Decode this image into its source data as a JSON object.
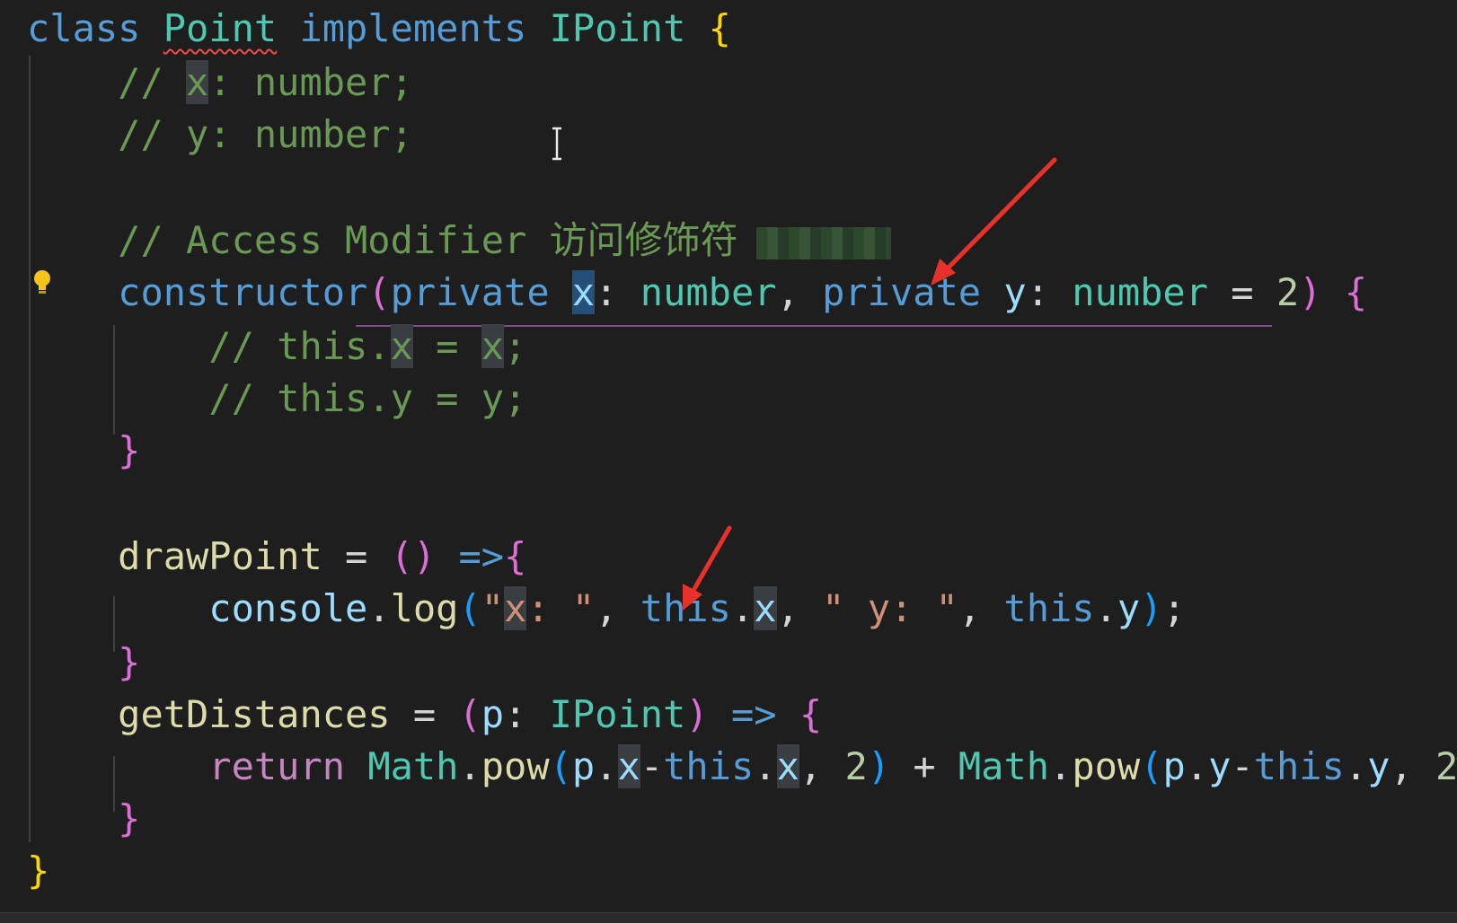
{
  "editor": {
    "lines": [
      {
        "tokens": [
          {
            "t": "class",
            "c": "kw"
          },
          {
            "t": " ",
            "c": ""
          },
          {
            "t": "Point",
            "c": "cls squiggle"
          },
          {
            "t": " ",
            "c": ""
          },
          {
            "t": "implements",
            "c": "kw"
          },
          {
            "t": " ",
            "c": ""
          },
          {
            "t": "IPoint",
            "c": "cls"
          },
          {
            "t": " ",
            "c": ""
          },
          {
            "t": "{",
            "c": "p1"
          }
        ]
      },
      {
        "tokens": [
          {
            "t": "    ",
            "c": ""
          },
          {
            "t": "// ",
            "c": "cm"
          },
          {
            "t": "x",
            "c": "cm hl"
          },
          {
            "t": ": number;",
            "c": "cm"
          }
        ]
      },
      {
        "tokens": [
          {
            "t": "    ",
            "c": ""
          },
          {
            "t": "// y: number;",
            "c": "cm"
          }
        ]
      },
      {
        "tokens": [
          {
            "t": "",
            "c": ""
          }
        ]
      },
      {
        "tokens": [
          {
            "t": "    ",
            "c": ""
          },
          {
            "t": "// Access Modifier 访问修饰符",
            "c": "cm"
          }
        ],
        "blur": true
      },
      {
        "tokens": [
          {
            "t": "    ",
            "c": ""
          },
          {
            "t": "constructor",
            "c": "kw"
          },
          {
            "t": "(",
            "c": "p2"
          },
          {
            "t": "private",
            "c": "kw"
          },
          {
            "t": " ",
            "c": ""
          },
          {
            "t": "x",
            "c": "var sel"
          },
          {
            "t": ": ",
            "c": ""
          },
          {
            "t": "number",
            "c": "cls"
          },
          {
            "t": ", ",
            "c": ""
          },
          {
            "t": "private",
            "c": "kw"
          },
          {
            "t": " ",
            "c": ""
          },
          {
            "t": "y",
            "c": "var"
          },
          {
            "t": ": ",
            "c": ""
          },
          {
            "t": "number",
            "c": "cls"
          },
          {
            "t": " = ",
            "c": ""
          },
          {
            "t": "2",
            "c": "num"
          },
          {
            "t": ")",
            "c": "p2"
          },
          {
            "t": " ",
            "c": ""
          },
          {
            "t": "{",
            "c": "p2"
          }
        ]
      },
      {
        "tokens": [
          {
            "t": "        ",
            "c": ""
          },
          {
            "t": "// this.",
            "c": "cm"
          },
          {
            "t": "x",
            "c": "cm hl"
          },
          {
            "t": " = ",
            "c": "cm"
          },
          {
            "t": "x",
            "c": "cm hl"
          },
          {
            "t": ";",
            "c": "cm"
          }
        ]
      },
      {
        "tokens": [
          {
            "t": "        ",
            "c": ""
          },
          {
            "t": "// this.y = y;",
            "c": "cm"
          }
        ]
      },
      {
        "tokens": [
          {
            "t": "    ",
            "c": ""
          },
          {
            "t": "}",
            "c": "p2"
          }
        ]
      },
      {
        "tokens": [
          {
            "t": "",
            "c": ""
          }
        ]
      },
      {
        "tokens": [
          {
            "t": "    ",
            "c": ""
          },
          {
            "t": "drawPoint",
            "c": "fn"
          },
          {
            "t": " = ",
            "c": ""
          },
          {
            "t": "()",
            "c": "p2"
          },
          {
            "t": " ",
            "c": ""
          },
          {
            "t": "=>",
            "c": "kw"
          },
          {
            "t": "{",
            "c": "p2"
          }
        ]
      },
      {
        "tokens": [
          {
            "t": "        ",
            "c": ""
          },
          {
            "t": "console",
            "c": "var"
          },
          {
            "t": ".",
            "c": ""
          },
          {
            "t": "log",
            "c": "fn"
          },
          {
            "t": "(",
            "c": "p3"
          },
          {
            "t": "\"",
            "c": "str"
          },
          {
            "t": "x",
            "c": "str hl"
          },
          {
            "t": ": \"",
            "c": "str"
          },
          {
            "t": ", ",
            "c": ""
          },
          {
            "t": "this",
            "c": "kw"
          },
          {
            "t": ".",
            "c": ""
          },
          {
            "t": "x",
            "c": "var hl"
          },
          {
            "t": ", ",
            "c": ""
          },
          {
            "t": "\" y: \"",
            "c": "str"
          },
          {
            "t": ", ",
            "c": ""
          },
          {
            "t": "this",
            "c": "kw"
          },
          {
            "t": ".",
            "c": ""
          },
          {
            "t": "y",
            "c": "var"
          },
          {
            "t": ")",
            "c": "p3"
          },
          {
            "t": ";",
            "c": ""
          }
        ]
      },
      {
        "tokens": [
          {
            "t": "    ",
            "c": ""
          },
          {
            "t": "}",
            "c": "p2"
          }
        ]
      },
      {
        "tokens": [
          {
            "t": "    ",
            "c": ""
          },
          {
            "t": "getDistances",
            "c": "fn"
          },
          {
            "t": " = ",
            "c": ""
          },
          {
            "t": "(",
            "c": "p2"
          },
          {
            "t": "p",
            "c": "var"
          },
          {
            "t": ": ",
            "c": ""
          },
          {
            "t": "IPoint",
            "c": "cls"
          },
          {
            "t": ")",
            "c": "p2"
          },
          {
            "t": " ",
            "c": ""
          },
          {
            "t": "=>",
            "c": "kw"
          },
          {
            "t": " ",
            "c": ""
          },
          {
            "t": "{",
            "c": "p2"
          }
        ]
      },
      {
        "tokens": [
          {
            "t": "        ",
            "c": ""
          },
          {
            "t": "return",
            "c": "ctl"
          },
          {
            "t": " ",
            "c": ""
          },
          {
            "t": "Math",
            "c": "cls"
          },
          {
            "t": ".",
            "c": ""
          },
          {
            "t": "pow",
            "c": "fn"
          },
          {
            "t": "(",
            "c": "p3"
          },
          {
            "t": "p",
            "c": "var"
          },
          {
            "t": ".",
            "c": ""
          },
          {
            "t": "x",
            "c": "var hl"
          },
          {
            "t": "-",
            "c": ""
          },
          {
            "t": "this",
            "c": "kw"
          },
          {
            "t": ".",
            "c": ""
          },
          {
            "t": "x",
            "c": "var hl"
          },
          {
            "t": ", ",
            "c": ""
          },
          {
            "t": "2",
            "c": "num"
          },
          {
            "t": ")",
            "c": "p3"
          },
          {
            "t": " + ",
            "c": ""
          },
          {
            "t": "Math",
            "c": "cls"
          },
          {
            "t": ".",
            "c": ""
          },
          {
            "t": "pow",
            "c": "fn"
          },
          {
            "t": "(",
            "c": "p3"
          },
          {
            "t": "p",
            "c": "var"
          },
          {
            "t": ".",
            "c": ""
          },
          {
            "t": "y",
            "c": "var"
          },
          {
            "t": "-",
            "c": ""
          },
          {
            "t": "this",
            "c": "kw"
          },
          {
            "t": ".",
            "c": ""
          },
          {
            "t": "y",
            "c": "var"
          },
          {
            "t": ", ",
            "c": ""
          },
          {
            "t": "2",
            "c": "num"
          },
          {
            "t": ")",
            "c": "p3"
          }
        ]
      },
      {
        "tokens": [
          {
            "t": "    ",
            "c": ""
          },
          {
            "t": "}",
            "c": "p2"
          }
        ]
      },
      {
        "tokens": [
          {
            "t": "}",
            "c": "p1"
          }
        ]
      }
    ]
  },
  "icons": {
    "lightbulb": "lightbulb-icon",
    "text_cursor": "text-cursor-icon",
    "annotation_arrow": "annotation-arrow-icon"
  },
  "colors": {
    "background": "#1e1e1e",
    "keyword": "#569cd6",
    "type": "#4ec9b0",
    "function": "#dcdcaa",
    "comment": "#6a9955",
    "annotation_arrow": "#e8312a",
    "lightbulb": "#f5c518"
  }
}
